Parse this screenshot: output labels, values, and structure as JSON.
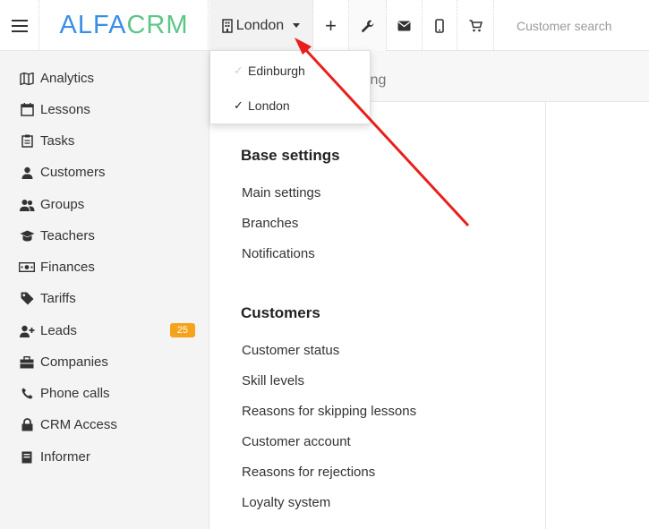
{
  "app": {
    "logo_part1": "ALFA",
    "logo_part2": "CRM"
  },
  "topbar": {
    "branch_label": "London",
    "plus_icon": "+",
    "search_placeholder": "Customer search"
  },
  "branch_menu": {
    "items": [
      {
        "label": "Edinburgh",
        "checked": false
      },
      {
        "label": "London",
        "checked": true
      }
    ]
  },
  "sidebar": {
    "items": [
      {
        "label": "Analytics",
        "icon": "map-icon"
      },
      {
        "label": "Lessons",
        "icon": "calendar-icon"
      },
      {
        "label": "Tasks",
        "icon": "clipboard-icon"
      },
      {
        "label": "Customers",
        "icon": "user-icon"
      },
      {
        "label": "Groups",
        "icon": "users-icon"
      },
      {
        "label": "Teachers",
        "icon": "graduation-cap-icon"
      },
      {
        "label": "Finances",
        "icon": "money-icon"
      },
      {
        "label": "Tariffs",
        "icon": "tag-icon"
      },
      {
        "label": "Leads",
        "icon": "user-plus-icon",
        "badge": "25"
      },
      {
        "label": "Companies",
        "icon": "briefcase-icon"
      },
      {
        "label": "Phone calls",
        "icon": "phone-icon"
      },
      {
        "label": "CRM Access",
        "icon": "lock-icon"
      },
      {
        "label": "Informer",
        "icon": "book-icon"
      }
    ]
  },
  "content": {
    "header_visible_text": "ing",
    "sections": [
      {
        "title": "Base settings",
        "links": [
          "Main settings",
          "Branches",
          "Notifications"
        ]
      },
      {
        "title": "Customers",
        "links": [
          "Customer status",
          "Skill levels",
          "Reasons for skipping lessons",
          "Customer account",
          "Reasons for rejections",
          "Loyalty system"
        ]
      }
    ]
  },
  "colors": {
    "logo_alfa": "#3a8ee6",
    "logo_crm": "#5cc686",
    "badge": "#f5a31a",
    "annotation_arrow": "#e8201c"
  }
}
